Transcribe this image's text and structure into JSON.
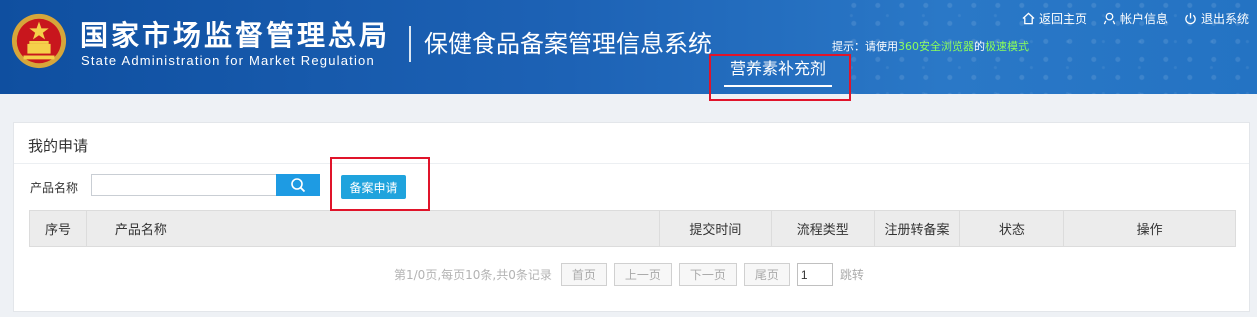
{
  "header": {
    "org_name_cn": "国家市场监督管理总局",
    "org_name_en": "State Administration for Market Regulation",
    "system_name": "保健食品备案管理信息系统",
    "tip_prefix": "提示：请使用",
    "tip_browser": "360安全浏览器",
    "tip_mid": "的",
    "tip_mode": "极速模式",
    "links": [
      {
        "label": "返回主页",
        "icon": "home-icon"
      },
      {
        "label": "帐户信息",
        "icon": "user-icon"
      },
      {
        "label": "退出系统",
        "icon": "power-icon"
      }
    ],
    "nav_tab": "营养素补充剂"
  },
  "panel": {
    "title": "我的申请",
    "search_label": "产品名称",
    "search_value": "",
    "search_icon": "search-icon",
    "apply_button": "备案申请",
    "columns": [
      "序号",
      "产品名称",
      "提交时间",
      "流程类型",
      "注册转备案",
      "状态",
      "操作"
    ]
  },
  "pager": {
    "info": "第1/0页,每页10条,共0条记录",
    "first": "首页",
    "prev": "上一页",
    "next": "下一页",
    "last": "尾页",
    "page_value": "1",
    "jump": "跳转"
  },
  "colors": {
    "header_blue": "#1d62b5",
    "accent_green": "#8cff5a",
    "button_blue": "#1fa3dd",
    "highlight_red": "#e0142a"
  }
}
